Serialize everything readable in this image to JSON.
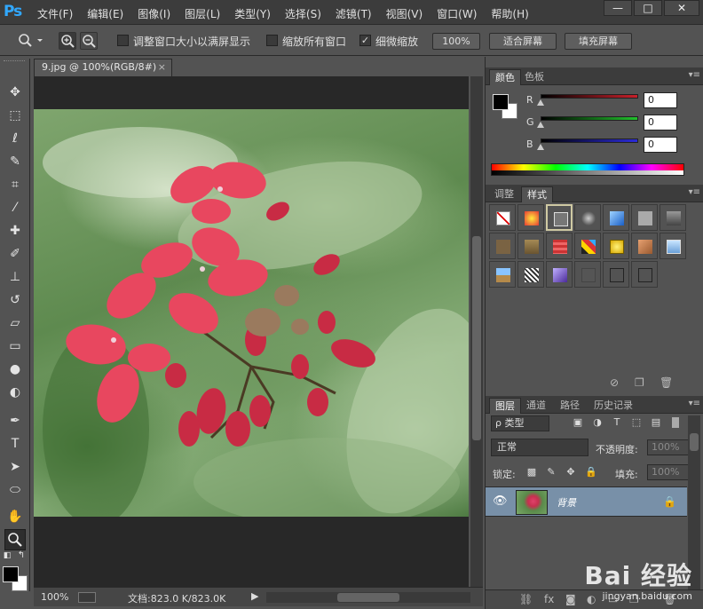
{
  "app": {
    "logo": "Ps",
    "menu": [
      "文件(F)",
      "编辑(E)",
      "图像(I)",
      "图层(L)",
      "类型(Y)",
      "选择(S)",
      "滤镜(T)",
      "视图(V)",
      "窗口(W)",
      "帮助(H)"
    ],
    "window_controls": {
      "minimize": "—",
      "maximize": "□",
      "close": "✕"
    }
  },
  "options_bar": {
    "resize_windows_label": "调整窗口大小以满屏显示",
    "resize_windows_checked": false,
    "zoom_all_label": "缩放所有窗口",
    "zoom_all_checked": false,
    "scrubby_zoom_label": "细微缩放",
    "scrubby_zoom_checked": true,
    "btn_100": "100%",
    "btn_fit": "适合屏幕",
    "btn_fill": "填充屏幕"
  },
  "document": {
    "tab_title": "9.jpg @ 100%(RGB/8#)",
    "tab_close": "×",
    "status_zoom": "100%",
    "status_doc": "文档:823.0 K/823.0K"
  },
  "color_panel": {
    "tabs": [
      "颜色",
      "色板"
    ],
    "active_tab": 0,
    "sliders": [
      {
        "label": "R",
        "value": "0",
        "color": "#c8202a"
      },
      {
        "label": "G",
        "value": "0",
        "color": "#22c12d"
      },
      {
        "label": "B",
        "value": "0",
        "color": "#2b2bd8"
      }
    ]
  },
  "styles_panel": {
    "tabs": [
      "调整",
      "样式"
    ],
    "active_tab": 1
  },
  "layers_panel": {
    "tabs": [
      "图层",
      "通道",
      "路径",
      "历史记录"
    ],
    "active_tab": 0,
    "filter_label": "ρ 类型",
    "blend_mode": "正常",
    "opacity_label": "不透明度:",
    "opacity_value": "100%",
    "lock_label": "锁定:",
    "fill_label": "填充:",
    "fill_value": "100%",
    "layers": [
      {
        "name": "背景",
        "visible": true,
        "locked": true
      }
    ]
  },
  "watermark": {
    "main": "Bai 经验",
    "sub": "jingyan.baidu.com"
  }
}
